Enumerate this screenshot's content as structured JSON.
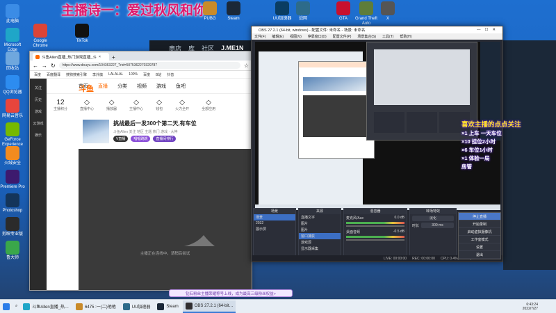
{
  "banner": "主播诗一：爱过秋风和你",
  "desktop_icons": [
    {
      "label": "此电脑",
      "color": "#3b8ce6"
    },
    {
      "label": "Microsoft Edge",
      "color": "#1fa6c8"
    },
    {
      "label": "回收站",
      "color": "#6fa7de"
    },
    {
      "label": "QQ浏览器",
      "color": "#2d8cf0"
    },
    {
      "label": "网易云音乐",
      "color": "#e8453c"
    },
    {
      "label": "GeForce Experience",
      "color": "#76b900"
    },
    {
      "label": "火绒安全",
      "color": "#f28b1f"
    },
    {
      "label": "Premiere Pro",
      "color": "#3d1a6e"
    },
    {
      "label": "Photoshop",
      "color": "#14355a"
    },
    {
      "label": "剪映专业版",
      "color": "#2b2b2b"
    },
    {
      "label": "鲁大师",
      "color": "#3aa74a"
    }
  ],
  "top_icons": [
    "Google Chrome",
    "TikTok",
    "PUBG",
    "Steam",
    "UU加速器",
    "战网",
    "GTA",
    "Grand Theft Auto",
    "X"
  ],
  "steam": {
    "nav": [
      "商店",
      "库",
      "社区"
    ],
    "user": "J.ME1N"
  },
  "browser": {
    "tab_title": "斗鱼Allen直播_热门游戏直播_斗",
    "url": "https://www.douyu.com/104363227_?rid=5075362270329787",
    "bookmarks": [
      "百度",
      "百度翻译",
      "搜狗搜索引擎",
      "李外旗",
      "LALALAL",
      "100%",
      "百度",
      "B站",
      "抖音"
    ],
    "side": [
      "关注",
      "历史",
      "游戏",
      "云游戏",
      "娱乐"
    ],
    "logo": "斗鱼",
    "nav": [
      "首页",
      "直播",
      "分类",
      "视频",
      "游戏",
      "鱼吧"
    ],
    "cats": [
      {
        "n": "12",
        "label": "主播积分"
      },
      {
        "n": "",
        "label": "直播中心"
      },
      {
        "n": "",
        "label": "播放器"
      },
      {
        "n": "",
        "label": "主播中心"
      },
      {
        "n": "",
        "label": "钱包"
      },
      {
        "n": "",
        "label": "火力全开"
      },
      {
        "n": "",
        "label": "全部应用"
      }
    ],
    "room_title": "挑战最后一发300个第二天,有车位",
    "room_meta": "斗鱼Allen  关注  地区  主题  热门  游戏 · 大神",
    "player_msg": "主播正在连线中，请稍后尝试",
    "room_tags": [
      "V直播",
      "唱唱跳跳",
      "直播间排行"
    ]
  },
  "toast": "钻石粉丝主播荣耀称号上线，成为最高三级粉丝权益>",
  "obs": {
    "title": "OBS 27.2.1 (64-bit, windows) - 配置文件: 未命名 - 场景: 未命名",
    "menu": [
      "文件(F)",
      "编辑(E)",
      "视图(V)",
      "停靠窗口(D)",
      "配置文件(P)",
      "场景集合(S)",
      "工具(T)",
      "帮助(H)"
    ],
    "scenes_title": "场景",
    "scenes": [
      "场景",
      "2032",
      "展示屏"
    ],
    "sources_title": "来源",
    "sources": [
      "直播文字",
      "图片",
      "图片",
      "窗口捕获",
      "游戏源",
      "显示器采集"
    ],
    "mixer_title": "混音器",
    "mixer": [
      {
        "name": "麦克风/Aux",
        "db": "0.0 dB"
      },
      {
        "name": "桌面音频",
        "db": "-0.5 dB"
      }
    ],
    "transitions_title": "转场特效",
    "transition": "淡化",
    "duration_label": "时长",
    "duration": "300 ms",
    "controls": [
      "停止直播",
      "开始录制",
      "启动虚拟摄像机",
      "工作室模式",
      "设置",
      "退出"
    ],
    "status": {
      "live": "LIVE: 00:00:00",
      "rec": "REC: 00:00:00",
      "cpu": "CPU: 0.4%, 60.00 fps"
    }
  },
  "overlay": {
    "welcome": "喜欢主播的点点关注",
    "lines": [
      "×1 上车 一天车位",
      "×10 挂位2小时",
      "×6 车位1小时",
      "×1 体验一局",
      "房管"
    ]
  },
  "taskbar": {
    "items": [
      "斗鱼Allen直播_热…",
      "6475 :一(二)他他",
      "UU加速器",
      "Steam",
      "OBS 27.2.1 (64-bit…"
    ],
    "time": "6:43:24",
    "date": "2022/7/27"
  }
}
